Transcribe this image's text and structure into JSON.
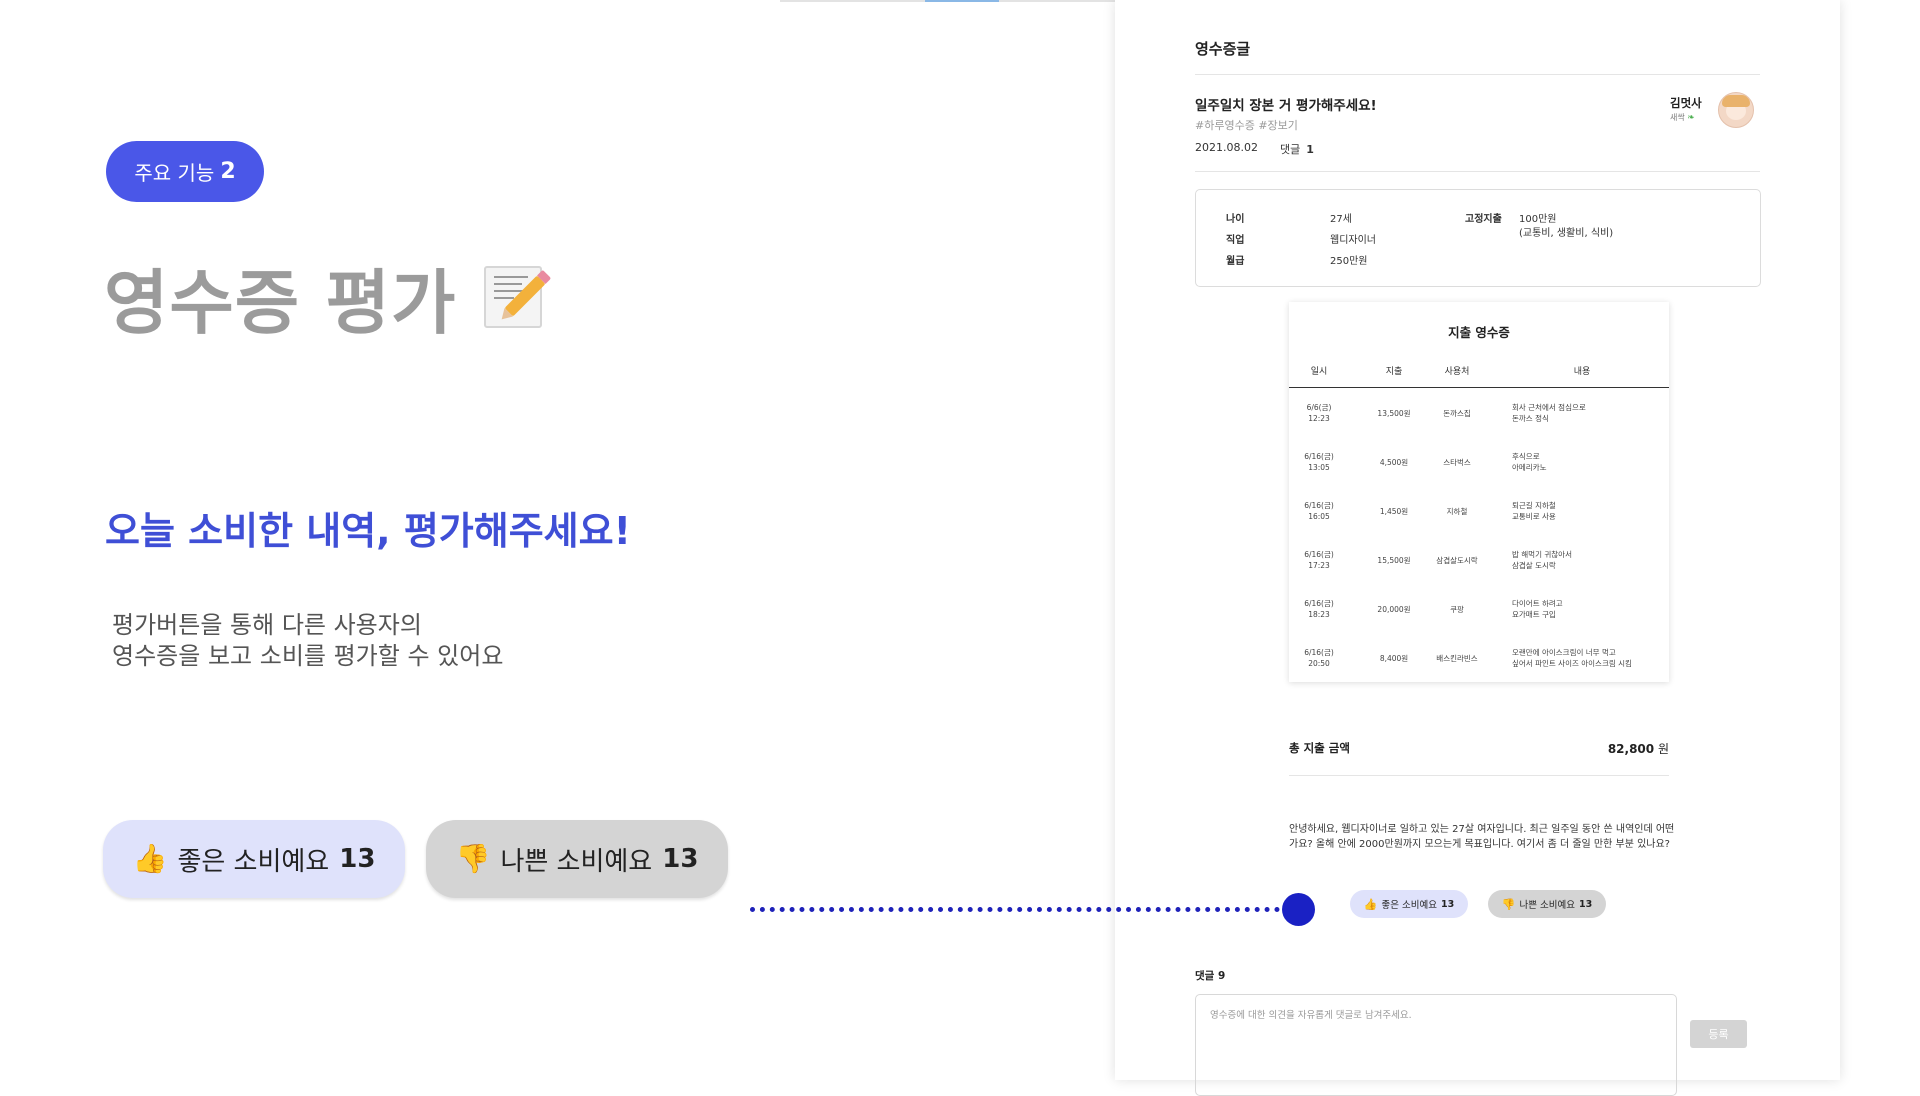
{
  "promo": {
    "pill_text": "주요 기능",
    "pill_number": "2",
    "heading": "영수증 평가",
    "subtitle": "오늘 소비한 내역, 평가해주세요!",
    "desc_lines": [
      "평가버튼을 통해 다른 사용자의",
      "영수증을 보고 소비를 평가할 수 있어요"
    ],
    "good_label": "좋은 소비예요",
    "good_count": "13",
    "bad_label": "나쁜 소비예요",
    "bad_count": "13",
    "icons": [
      "memo-icon",
      "thumbs-up-icon",
      "thumbs-down-icon"
    ]
  },
  "panel": {
    "board_title": "영수증글",
    "post": {
      "title": "일주일치 장본 거 평가해주세요!",
      "tags": "#하루영수증 #장보기",
      "date": "2021.08.02",
      "comment_label": "댓글",
      "comment_count": "1",
      "author": "김멋사",
      "grade": "새싹"
    },
    "info": {
      "age_label": "나이",
      "age": "27세",
      "job_label": "직업",
      "job": "웹디자이너",
      "salary_label": "월급",
      "salary": "250만원",
      "fixed_label": "고정지출",
      "fixed": "100만원",
      "fixed_detail": "(교통비, 생활비, 식비)"
    },
    "receipt": {
      "title": "지출 영수증",
      "headers": [
        "일시",
        "지출",
        "사용처",
        "내용"
      ],
      "rows": [
        {
          "date1": "6/6(금)",
          "date2": "12:23",
          "amount": "13,500원",
          "place": "돈까스집",
          "desc1": "회사 근처에서 점심으로",
          "desc2": "돈까스 정식"
        },
        {
          "date1": "6/16(금)",
          "date2": "13:05",
          "amount": "4,500원",
          "place": "스타벅스",
          "desc1": "후식으로",
          "desc2": "아메리카노"
        },
        {
          "date1": "6/16(금)",
          "date2": "16:05",
          "amount": "1,450원",
          "place": "지하철",
          "desc1": "퇴근길 지하철",
          "desc2": "교통비로 사용"
        },
        {
          "date1": "6/16(금)",
          "date2": "17:23",
          "amount": "15,500원",
          "place": "삼겹살도시락",
          "desc1": "밥 해먹기 귀찮아서",
          "desc2": "삼겹살 도시락"
        },
        {
          "date1": "6/16(금)",
          "date2": "18:23",
          "amount": "20,000원",
          "place": "쿠팡",
          "desc1": "다이어트 하려고",
          "desc2": "요가매트 구입"
        },
        {
          "date1": "6/16(금)",
          "date2": "20:50",
          "amount": "8,400원",
          "place": "배스킨라빈스",
          "desc1": "오랜만에 아이스크림이 너무 먹고",
          "desc2": "싶어서 파인트 사이즈 아이스크림 시킴"
        }
      ]
    },
    "total_label": "총 지출 금액",
    "total_value": "82,800",
    "total_unit": "원",
    "body_text": "안녕하세요, 웹디자이너로 일하고 있는 27살 여자입니다. 최근 일주일 동안 쓴 내역인데 어떤가요? 올해 안에 2000만원까지 모으는게 목표입니다. 여기서 좀 더 줄일 만한 부분 있나요?",
    "good_label": "좋은 소비예요",
    "good_count": "13",
    "bad_label": "나쁜 소비예요",
    "bad_count": "13",
    "comments_label": "댓글",
    "comments_count": "9",
    "comment_placeholder": "영수증에 대한 의견을 자유롭게 댓글로 남겨주세요.",
    "submit_label": "등록",
    "colors": {
      "accent": "#4a57e8",
      "connector": "#1f22b9",
      "good_bg": "#dfe2fb",
      "bad_bg": "#d4d4d4"
    }
  }
}
